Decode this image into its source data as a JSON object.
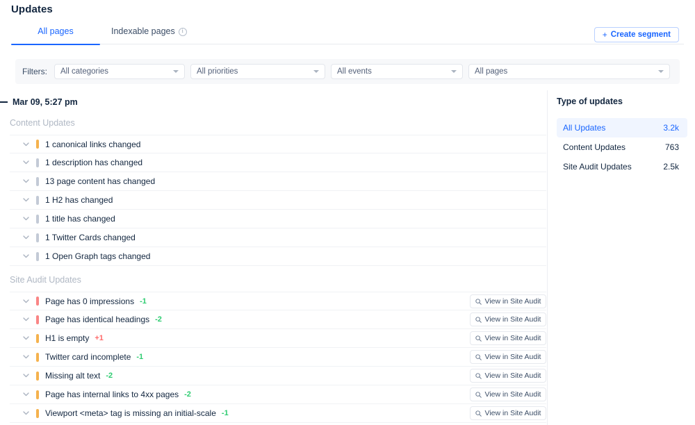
{
  "header": {
    "title": "Updates",
    "create_segment_label": "Create segment",
    "create_segment_plus": "+"
  },
  "tabs": [
    {
      "label": "All pages",
      "active": true,
      "has_info": false
    },
    {
      "label": "Indexable pages",
      "active": false,
      "has_info": true
    }
  ],
  "filters": {
    "label": "Filters:",
    "selects": [
      {
        "value": "All categories"
      },
      {
        "value": "All priorities"
      },
      {
        "value": "All events"
      },
      {
        "value": "All pages"
      }
    ]
  },
  "date_group": {
    "date": "Mar 09, 5:27 pm"
  },
  "sections": [
    {
      "label": "Content Updates",
      "rows": [
        {
          "label": "1 canonical links changed",
          "priority_color": "#f5b24d",
          "delta": "",
          "delta_dir": "",
          "action": ""
        },
        {
          "label": "1 description has changed",
          "priority_color": "#c3cad6",
          "delta": "",
          "delta_dir": "",
          "action": ""
        },
        {
          "label": "13 page content has changed",
          "priority_color": "#c3cad6",
          "delta": "",
          "delta_dir": "",
          "action": ""
        },
        {
          "label": "1 H2 has changed",
          "priority_color": "#c3cad6",
          "delta": "",
          "delta_dir": "",
          "action": ""
        },
        {
          "label": "1 title has changed",
          "priority_color": "#c3cad6",
          "delta": "",
          "delta_dir": "",
          "action": ""
        },
        {
          "label": "1 Twitter Cards changed",
          "priority_color": "#c3cad6",
          "delta": "",
          "delta_dir": "",
          "action": ""
        },
        {
          "label": "1 Open Graph tags changed",
          "priority_color": "#c3cad6",
          "delta": "",
          "delta_dir": "",
          "action": ""
        }
      ]
    },
    {
      "label": "Site Audit Updates",
      "rows": [
        {
          "label": "Page has 0 impressions",
          "priority_color": "#fa8585",
          "delta": "-1",
          "delta_dir": "down",
          "action": "View in Site Audit"
        },
        {
          "label": "Page has identical headings",
          "priority_color": "#fa8585",
          "delta": "-2",
          "delta_dir": "down",
          "action": "View in Site Audit"
        },
        {
          "label": "H1 is empty",
          "priority_color": "#f5b24d",
          "delta": "+1",
          "delta_dir": "up",
          "action": "View in Site Audit"
        },
        {
          "label": "Twitter card incomplete",
          "priority_color": "#f5b24d",
          "delta": "-1",
          "delta_dir": "down",
          "action": "View in Site Audit"
        },
        {
          "label": "Missing alt text",
          "priority_color": "#f5b24d",
          "delta": "-2",
          "delta_dir": "down",
          "action": "View in Site Audit"
        },
        {
          "label": "Page has internal links to 4xx pages",
          "priority_color": "#f5b24d",
          "delta": "-2",
          "delta_dir": "down",
          "action": "View in Site Audit"
        },
        {
          "label": "Viewport <meta> tag is missing an initial-scale",
          "priority_color": "#f5b24d",
          "delta": "-1",
          "delta_dir": "down",
          "action": "View in Site Audit"
        }
      ]
    }
  ],
  "right_panel": {
    "title": "Type of updates",
    "items": [
      {
        "label": "All Updates",
        "value": "3.2k",
        "active": true
      },
      {
        "label": "Content Updates",
        "value": "763",
        "active": false
      },
      {
        "label": "Site Audit Updates",
        "value": "2.5k",
        "active": false
      }
    ]
  },
  "colors": {
    "accent": "#1a66ff",
    "positive": "#2ecc71",
    "negative": "#ff6b6b",
    "priority_high": "#fa8585",
    "priority_medium": "#f5b24d",
    "priority_low": "#c3cad6"
  }
}
